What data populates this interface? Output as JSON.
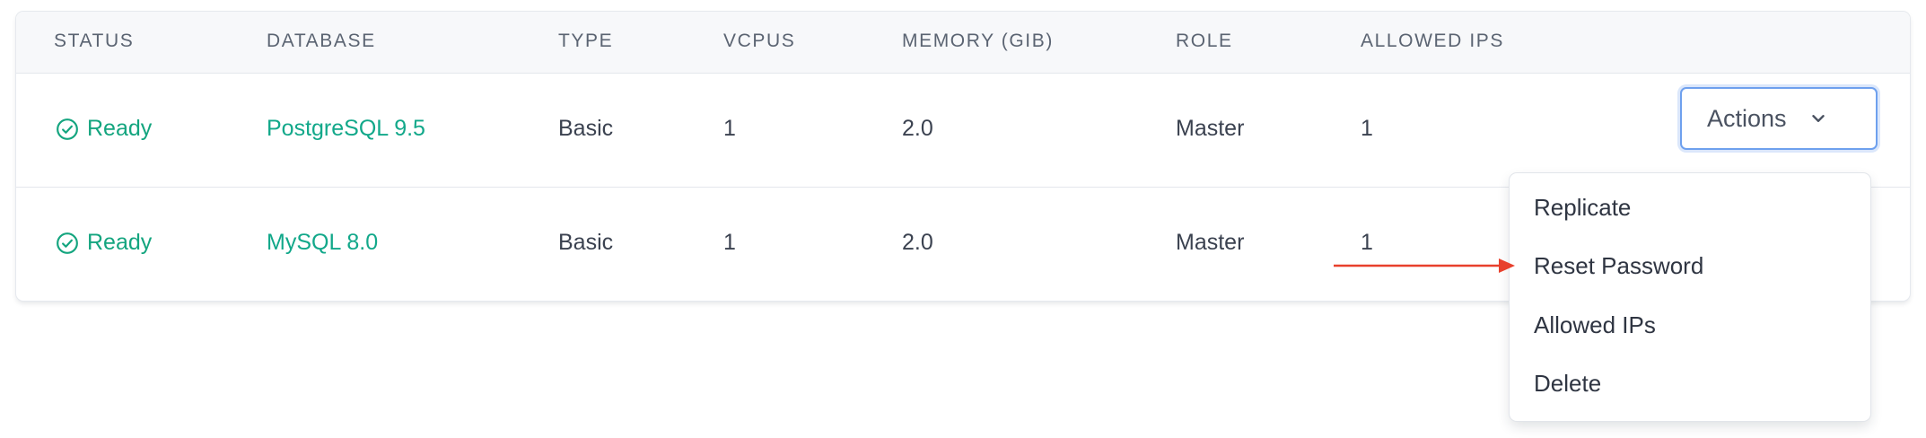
{
  "table": {
    "headers": {
      "status": "STATUS",
      "database": "DATABASE",
      "type": "TYPE",
      "vcpus": "VCPUS",
      "memory": "MEMORY (GIB)",
      "role": "ROLE",
      "allowed_ips": "ALLOWED IPS"
    },
    "rows": [
      {
        "status": "Ready",
        "database": "PostgreSQL 9.5",
        "type": "Basic",
        "vcpus": "1",
        "memory": "2.0",
        "role": "Master",
        "allowed_ips": "1"
      },
      {
        "status": "Ready",
        "database": "MySQL 8.0",
        "type": "Basic",
        "vcpus": "1",
        "memory": "2.0",
        "role": "Master",
        "allowed_ips": "1"
      }
    ]
  },
  "actions_button": {
    "label": "Actions",
    "icon": "chevron-down-icon"
  },
  "actions_menu": {
    "items": [
      {
        "label": "Replicate"
      },
      {
        "label": "Reset Password"
      },
      {
        "label": "Allowed IPs"
      },
      {
        "label": "Delete"
      }
    ]
  },
  "icons": {
    "status": "check-circle-icon"
  },
  "colors": {
    "ready": "#14a57f",
    "link": "#12a88a",
    "focus_ring": "#6ea0ee",
    "annotation_arrow": "#e8402c"
  }
}
